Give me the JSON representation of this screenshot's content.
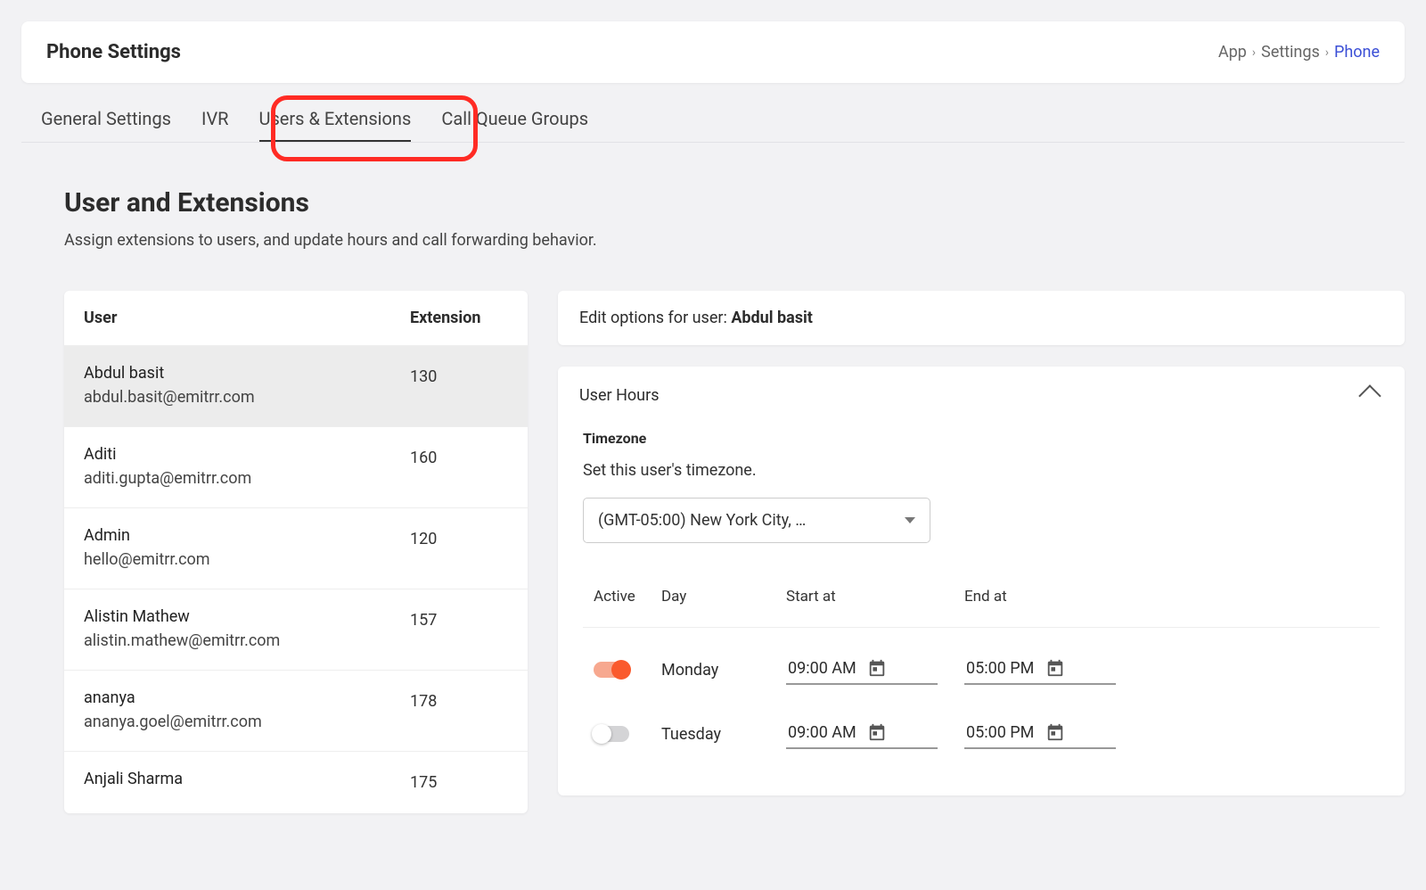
{
  "header": {
    "title": "Phone Settings",
    "breadcrumb": {
      "app": "App",
      "settings": "Settings",
      "current": "Phone"
    }
  },
  "tabs": {
    "general": "General Settings",
    "ivr": "IVR",
    "users": "Users & Extensions",
    "queue": "Call Queue Groups"
  },
  "section": {
    "title": "User and Extensions",
    "desc": "Assign extensions to users, and update hours and call forwarding behavior."
  },
  "list": {
    "header_user": "User",
    "header_ext": "Extension",
    "rows": [
      {
        "name": "Abdul basit",
        "email": "abdul.basit@emitrr.com",
        "ext": "130"
      },
      {
        "name": "Aditi",
        "email": "aditi.gupta@emitrr.com",
        "ext": "160"
      },
      {
        "name": "Admin",
        "email": "hello@emitrr.com",
        "ext": "120"
      },
      {
        "name": "Alistin Mathew",
        "email": "alistin.mathew@emitrr.com",
        "ext": "157"
      },
      {
        "name": "ananya",
        "email": "ananya.goel@emitrr.com",
        "ext": "178"
      },
      {
        "name": "Anjali Sharma",
        "email": "",
        "ext": "175"
      }
    ]
  },
  "edit": {
    "prefix": "Edit options for user: ",
    "user": "Abdul basit"
  },
  "hours": {
    "title": "User Hours",
    "timezone_label": "Timezone",
    "timezone_desc": "Set this user's timezone.",
    "timezone_value": "(GMT-05:00) New York City, …",
    "col_active": "Active",
    "col_day": "Day",
    "col_start": "Start at",
    "col_end": "End at",
    "rows": [
      {
        "active": true,
        "day": "Monday",
        "start": "09:00 AM",
        "end": "05:00 PM"
      },
      {
        "active": false,
        "day": "Tuesday",
        "start": "09:00 AM",
        "end": "05:00 PM"
      }
    ]
  }
}
